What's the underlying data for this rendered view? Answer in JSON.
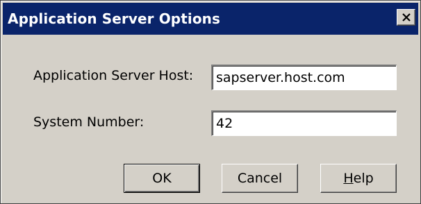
{
  "window": {
    "title": "Application Server Options"
  },
  "form": {
    "host_label": "Application Server Host:",
    "host_value": "sapserver.host.com",
    "sysnum_label": "System Number:",
    "sysnum_value": "42"
  },
  "buttons": {
    "ok_label": "OK",
    "cancel_label": "Cancel",
    "help_mnemonic": "H",
    "help_rest": "elp"
  },
  "icons": {
    "close": "close-icon"
  },
  "colors": {
    "titlebar": "#0a246a",
    "dialog_bg": "#d4d0c8"
  }
}
